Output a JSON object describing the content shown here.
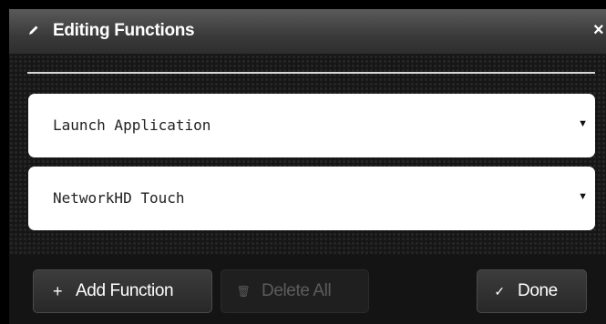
{
  "dialog": {
    "title": "Editing Functions",
    "title_icon": "pencil-icon",
    "close_label": "×"
  },
  "functions": [
    {
      "value": "Launch Application",
      "caret": "▼"
    },
    {
      "value": "NetworkHD Touch",
      "caret": "▼"
    }
  ],
  "footer": {
    "add": {
      "icon": "+",
      "label": "Add Function"
    },
    "delete": {
      "icon": "🗑",
      "label": "Delete All",
      "enabled": false
    },
    "done": {
      "icon": "✓",
      "label": "Done"
    }
  },
  "colors": {
    "titlebar": "#3a3a3a",
    "panel": "#141414",
    "disabled_text": "#5c5c5c"
  }
}
